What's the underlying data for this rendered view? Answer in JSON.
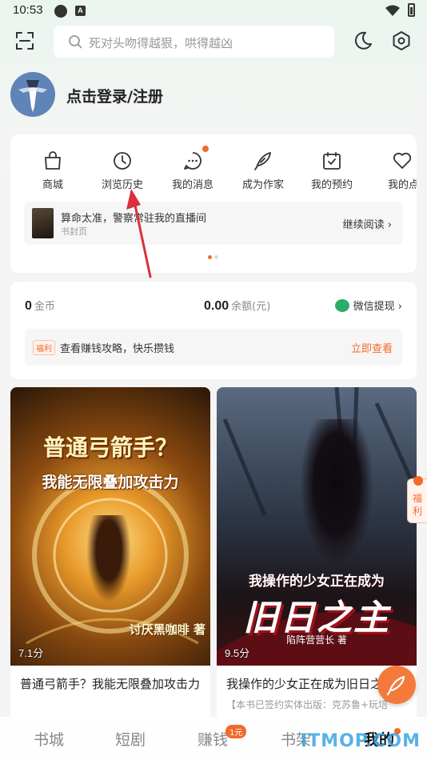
{
  "status_bar": {
    "time": "10:53",
    "icon_b_label": "A"
  },
  "search": {
    "placeholder": "死对头吻得越狠，哄得越凶"
  },
  "profile": {
    "login_text": "点击登录/注册"
  },
  "menu": {
    "items": [
      {
        "label": "商城",
        "icon": "shopping-bag-icon"
      },
      {
        "label": "浏览历史",
        "icon": "clock-icon"
      },
      {
        "label": "我的消息",
        "icon": "message-icon",
        "badge": true
      },
      {
        "label": "成为作家",
        "icon": "feather-pen-icon"
      },
      {
        "label": "我的预约",
        "icon": "calendar-check-icon"
      },
      {
        "label": "我的点",
        "icon": "heart-icon"
      }
    ],
    "reading": {
      "title": "算命太准，警察常驻我的直播间",
      "subtitle": "书封页",
      "continue_label": "继续阅读 ›"
    }
  },
  "wallet": {
    "coins_value": "0",
    "coins_unit": "金币",
    "balance_value": "0.00",
    "balance_unit": "余额(元)",
    "withdraw_label": "微信提现 ›",
    "welfare_tag": "福利",
    "earn_text": "查看赚钱攻略，快乐攒钱",
    "earn_link": "立即查看"
  },
  "books": [
    {
      "cover_line1": "普通弓箭手？",
      "cover_line2": "我能无限叠加攻击力",
      "cover_author": "讨厌黑咖啡 著",
      "score": "7.1分",
      "title": "普通弓箭手？我能无限叠加攻击力",
      "desc": ""
    },
    {
      "cover_line1": "我操作的少女正在成为",
      "cover_line2": "旧日之主",
      "cover_author": "陷阵营营长 著",
      "score": "9.5分",
      "title": "我操作的少女正在成为旧日之主",
      "desc": "【本书已签约实体出版：克苏鲁+玩培"
    }
  ],
  "side_welfare": {
    "label": "福利"
  },
  "tabs": [
    {
      "label": "书城",
      "active": false
    },
    {
      "label": "短剧",
      "active": false
    },
    {
      "label": "赚钱",
      "active": false,
      "badge": "1元"
    },
    {
      "label": "书架",
      "active": false
    },
    {
      "label": "我的",
      "active": true
    }
  ],
  "watermark": "ITMOP.COM",
  "colors": {
    "accent": "#f26b2a",
    "wechat": "#2aae67",
    "annotation_arrow": "#d9303a"
  }
}
